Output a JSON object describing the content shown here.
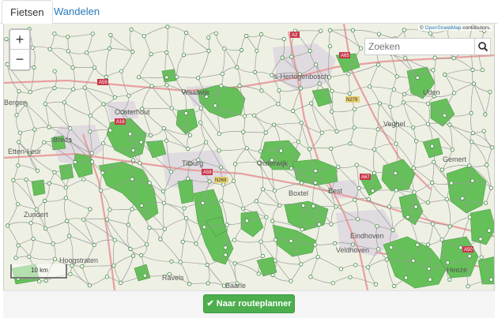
{
  "tabs": [
    {
      "label": "Fietsen",
      "active": true
    },
    {
      "label": "Wandelen",
      "active": false
    }
  ],
  "map": {
    "zoom_in": "+",
    "zoom_out": "−",
    "search_placeholder": "Zoeken",
    "attribution_prefix": "© ",
    "attribution_link": "OpenStreetMap",
    "attribution_suffix": " contributors.",
    "scale_label": "10 km",
    "places": [
      "'s-Hertogenbosch",
      "Breda",
      "Tilburg",
      "Eindhoven",
      "Bergen",
      "Etten-Leur",
      "Zundert",
      "Hoogstraten",
      "Waalwijk",
      "Oisterwijk",
      "Boxtel",
      "Best",
      "Veghel",
      "Uden",
      "Gemert",
      "Veldhoven",
      "Ravels",
      "Baarle",
      "Oosterhout",
      "Heeze"
    ],
    "roads": [
      "A2",
      "A59",
      "A58",
      "A65",
      "A16",
      "N279",
      "A67",
      "A50",
      "N269"
    ],
    "colors": {
      "forest": "#66c05a",
      "route": "#9a9a9a",
      "node": "#3d8a3d",
      "highway": "#e8a0a0"
    }
  },
  "footer": {
    "route_button": "Naar routeplanner",
    "route_icon": "check-icon"
  }
}
